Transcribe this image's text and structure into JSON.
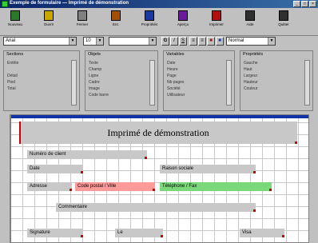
{
  "window": {
    "title": "Exemple de formulaire — Imprimé de démonstration"
  },
  "toolbar": [
    {
      "label": "Nouveau",
      "icon": "new-icon",
      "color": "#2a7a2a"
    },
    {
      "label": "Ouvrir",
      "icon": "open-icon",
      "color": "#c8a800"
    },
    {
      "label": "Fermer",
      "icon": "close-icon",
      "color": "#808080"
    },
    {
      "label": "Enr.",
      "icon": "save-icon",
      "color": "#a05000"
    },
    {
      "label": "Propriétés",
      "icon": "properties-icon",
      "color": "#1a3aa0"
    },
    {
      "label": "Aperçu",
      "icon": "preview-icon",
      "color": "#6a1a9a"
    },
    {
      "label": "Imprimer",
      "icon": "print-icon",
      "color": "#b01010"
    },
    {
      "label": "Aide",
      "icon": "help-icon",
      "color": "#303030"
    },
    {
      "label": "Quitter",
      "icon": "exit-icon",
      "color": "#303030"
    }
  ],
  "format": {
    "font": "Arial",
    "size": "10",
    "style": "",
    "zoom": "Normal"
  },
  "panels": [
    {
      "title": "Sections",
      "items": [
        "Entête",
        "",
        "Détail",
        "Pied",
        "Total"
      ]
    },
    {
      "title": "Objets",
      "items": [
        "Texte",
        "Champ",
        "Ligne",
        "Cadre",
        "Image",
        "Code barre"
      ]
    },
    {
      "title": "Variables",
      "items": [
        "Date",
        "Heure",
        "Page",
        "Nb pages",
        "Société",
        "Utilisateur"
      ]
    },
    {
      "title": "Propriétés",
      "items": [
        "Gauche",
        "Haut",
        "Largeur",
        "Hauteur",
        "Couleur"
      ]
    }
  ],
  "design": {
    "heading": "Imprimé de démonstration",
    "fields": [
      {
        "text": "Numéro de client",
        "color": "#c8c8c8"
      },
      {
        "text": "Date",
        "color": "#c8c8c8"
      },
      {
        "text": "Raison sociale",
        "color": "#c8c8c8"
      },
      {
        "text": "Adresse",
        "color": "#c8c8c8"
      },
      {
        "text": "Code postal / Ville",
        "color": "#ff9a9a"
      },
      {
        "text": "Téléphone / Fax",
        "color": "#7ad87a"
      },
      {
        "text": "Commentaire",
        "color": "#c8c8c8"
      },
      {
        "text": "Signature",
        "color": "#c8c8c8"
      },
      {
        "text": "Le",
        "color": "#c8c8c8"
      },
      {
        "text": "Visa",
        "color": "#c8c8c8"
      }
    ]
  },
  "colors": {
    "accent": "#1034a6",
    "marker": "#cc0000"
  }
}
